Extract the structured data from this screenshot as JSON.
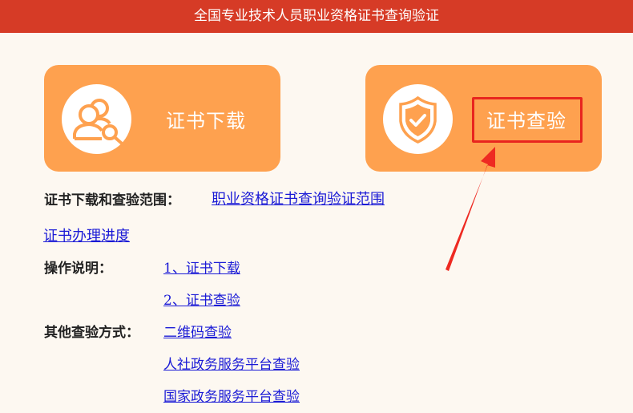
{
  "header": {
    "title": "全国专业技术人员职业资格证书查询验证"
  },
  "cards": {
    "download": {
      "label": "证书下载",
      "icon": "user-search-icon"
    },
    "verify": {
      "label": "证书查验",
      "icon": "shield-check-icon"
    }
  },
  "scope": {
    "label": "证书下载和查验范围：",
    "link": "职业资格证书查询验证范围"
  },
  "progress": {
    "link": "证书办理进度"
  },
  "instructions": {
    "label": "操作说明：",
    "items": [
      "1、证书下载",
      "2、证书查验"
    ]
  },
  "other_methods": {
    "label": "其他查验方式：",
    "items": [
      "二维码查验",
      "人社政务服务平台查验",
      "国家政务服务平台查验"
    ]
  },
  "colors": {
    "header_bg": "#d63b26",
    "card_bg": "#fea14f",
    "link": "#1a1ad6",
    "highlight": "#e8251f"
  }
}
